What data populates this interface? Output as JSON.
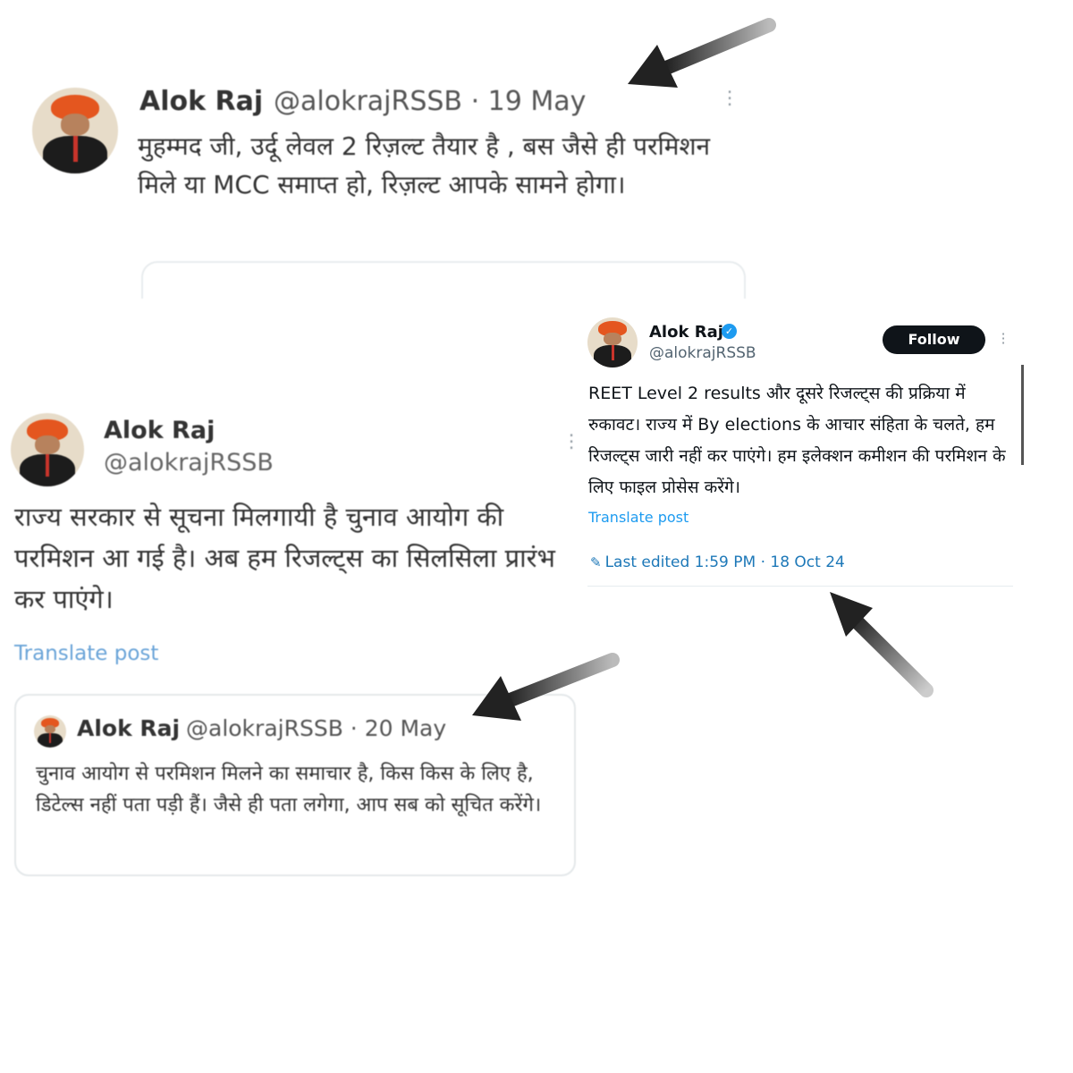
{
  "tweet_top": {
    "name": "Alok Raj",
    "handle": "@alokrajRSSB",
    "separator": "·",
    "date": "19 May",
    "text": "मुहम्मद जी, उर्दू लेवल 2 रिज़ल्ट तैयार है , बस जैसे  ही परमिशन मिले या MCC समाप्त हो, रिज़ल्ट आपके सामने होगा।"
  },
  "tweet_left": {
    "name": "Alok Raj",
    "handle": "@alokrajRSSB",
    "text": "राज्य सरकार से सूचना मिलगायी है चुनाव आयोग की परमिशन आ गई है। अब हम रिजल्ट्स का सिलसिला प्रारंभ कर पाएंगे।",
    "translate": "Translate post",
    "quoted": {
      "name": "Alok Raj",
      "handle": "@alokrajRSSB",
      "separator": "·",
      "date": "20 May",
      "text": "चुनाव आयोग से परमिशन मिलने का समाचार है, किस किस के लिए है, डिटेल्स नहीं पता पड़ी हैं। जैसे ही पता लगेगा, आप सब को सूचित करेंगे।"
    }
  },
  "tweet_right": {
    "name": "Alok Raj",
    "handle": "@alokrajRSSB",
    "follow_label": "Follow",
    "text": "REET Level 2 results और दूसरे रिजल्ट्स की प्रक्रिया में रुकावट। राज्य में By elections के आचार संहिता के चलते, हम रिजल्ट्स जारी नहीं कर पाएंगे। हम इलेक्शन कमीशन की परमिशन के लिए फाइल प्रोसेस करेंगे।",
    "translate": "Translate post",
    "edited": "Last edited 1:59 PM · 18 Oct 24"
  },
  "icons": {
    "verified": "verified-badge-icon",
    "more": "more-options-icon",
    "edit": "pencil-icon",
    "arrow": "annotation-arrow"
  },
  "colors": {
    "link": "#1d9bf0",
    "follow_bg": "#0f1419",
    "arrow": "#333333"
  }
}
